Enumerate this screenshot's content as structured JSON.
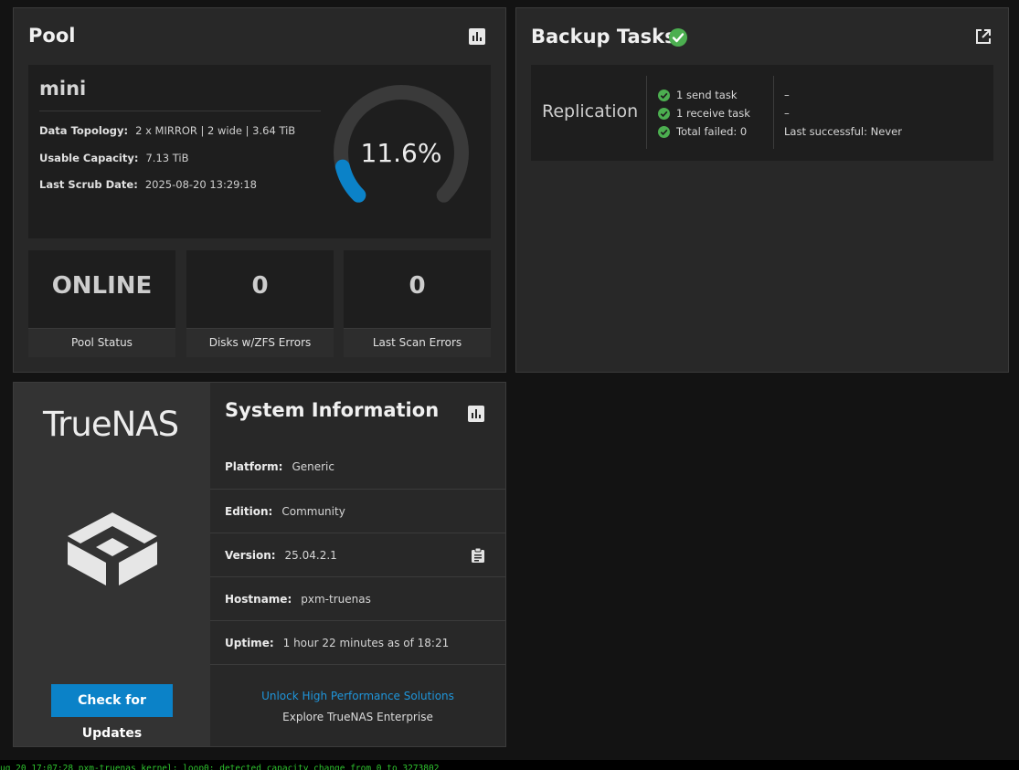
{
  "pool": {
    "title": "Pool",
    "name": "mini",
    "rows": [
      {
        "label": "Data Topology:",
        "value": "2 x MIRROR | 2 wide | 3.64 TiB"
      },
      {
        "label": "Usable Capacity:",
        "value": "7.13 TiB"
      },
      {
        "label": "Last Scrub Date:",
        "value": "2025-08-20 13:29:18"
      }
    ],
    "usage_text": "11.6%",
    "usage_fraction": 0.116,
    "stats": [
      {
        "value": "ONLINE",
        "label": "Pool Status"
      },
      {
        "value": "0",
        "label": "Disks w/ZFS Errors"
      },
      {
        "value": "0",
        "label": "Last Scan Errors"
      }
    ]
  },
  "backup": {
    "title": "Backup Tasks",
    "type_label": "Replication",
    "tasks": [
      "1 send task",
      "1 receive task",
      "Total failed: 0"
    ],
    "details": [
      "–",
      "–",
      "Last successful: Never"
    ]
  },
  "system": {
    "logo_text": "TrueNAS",
    "title": "System Information",
    "update_button": "Check for Updates",
    "rows": [
      {
        "label": "Platform:",
        "value": "Generic"
      },
      {
        "label": "Edition:",
        "value": "Community"
      },
      {
        "label": "Version:",
        "value": "25.04.2.1"
      },
      {
        "label": "Hostname:",
        "value": "pxm-truenas"
      },
      {
        "label": "Uptime:",
        "value": "1 hour 22 minutes as of 18:21"
      }
    ],
    "promo_link": "Unlock High Performance Solutions",
    "promo_sub": "Explore TrueNAS Enterprise"
  },
  "console": {
    "line": "ug 20 17:07:28 pxm-truenas kernel: loop0: detected capacity change from 0 to 3273802"
  },
  "colors": {
    "accent": "#0b82c8",
    "success": "#4caf50",
    "gauge_track": "#3a3a3a"
  }
}
